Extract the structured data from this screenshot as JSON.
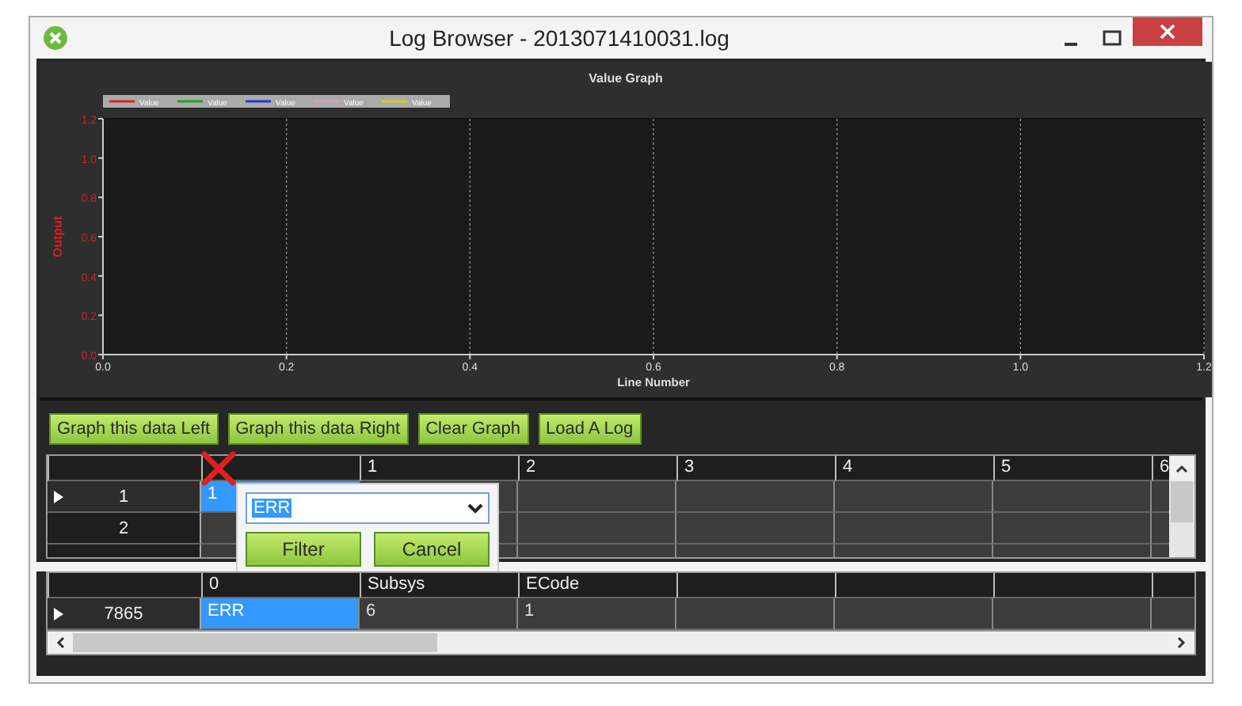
{
  "window": {
    "title": "Log Browser - 2013071410031.log"
  },
  "chart": {
    "chart_data": {
      "type": "line",
      "title": "Value Graph",
      "xlabel": "Line Number",
      "ylabel": "Output",
      "series": [
        {
          "name": "Value",
          "color": "#e02020",
          "values": [
            null,
            null,
            null,
            null,
            null,
            null,
            null
          ]
        },
        {
          "name": "Value",
          "color": "#20a020",
          "values": [
            null,
            null,
            null,
            null,
            null,
            null,
            null
          ]
        },
        {
          "name": "Value",
          "color": "#3030e0",
          "values": [
            null,
            null,
            null,
            null,
            null,
            null,
            null
          ]
        },
        {
          "name": "Value",
          "color": "#d0a0c0",
          "values": [
            null,
            null,
            null,
            null,
            null,
            null,
            null
          ]
        },
        {
          "name": "Value",
          "color": "#d0d020",
          "values": [
            null,
            null,
            null,
            null,
            null,
            null,
            null
          ]
        }
      ],
      "categories": [
        "0.0",
        "0.2",
        "0.4",
        "0.6",
        "0.8",
        "1.0",
        "1.2"
      ],
      "ylim": [
        0,
        1.2
      ],
      "grid": true,
      "yticks": [
        {
          "value": 0,
          "label": "0.0"
        },
        {
          "value": 0.2,
          "label": "0.2"
        },
        {
          "value": 0.4,
          "label": "0.4"
        },
        {
          "value": 0.6,
          "label": "0.6"
        },
        {
          "value": 0.8,
          "label": "0.8"
        },
        {
          "value": 1,
          "label": "1.0"
        },
        {
          "value": 1.2,
          "label": "1.2"
        }
      ]
    }
  },
  "buttons": [
    "Graph this data Left",
    "Graph this data Right",
    "Clear Graph",
    "Load A Log"
  ],
  "upper_grid": {
    "columns": [
      {},
      {
        "label": "1"
      },
      {
        "label": "2"
      },
      {
        "label": "3"
      },
      {
        "label": "4"
      },
      {
        "label": "5"
      },
      {
        "label": "6"
      }
    ],
    "rows": [
      {
        "header": "1",
        "current": true,
        "cells": [
          {
            "text": "1",
            "selected": true
          }
        ]
      },
      {
        "header": "2",
        "current": false
      }
    ]
  },
  "filter_popup": {
    "value": "ERR",
    "buttons": [
      "Filter",
      "Cancel"
    ]
  },
  "lower_grid": {
    "columns": [
      {
        "label": "0"
      },
      {
        "label": "Subsys"
      },
      {
        "label": "ECode"
      },
      {},
      {},
      {},
      {}
    ],
    "rows": [
      {
        "header": "7865",
        "current": true,
        "cells": [
          {
            "text": "ERR",
            "selected": true
          },
          {
            "text": "6",
            "selected": false
          },
          {
            "text": "1",
            "selected": false
          }
        ]
      }
    ]
  }
}
